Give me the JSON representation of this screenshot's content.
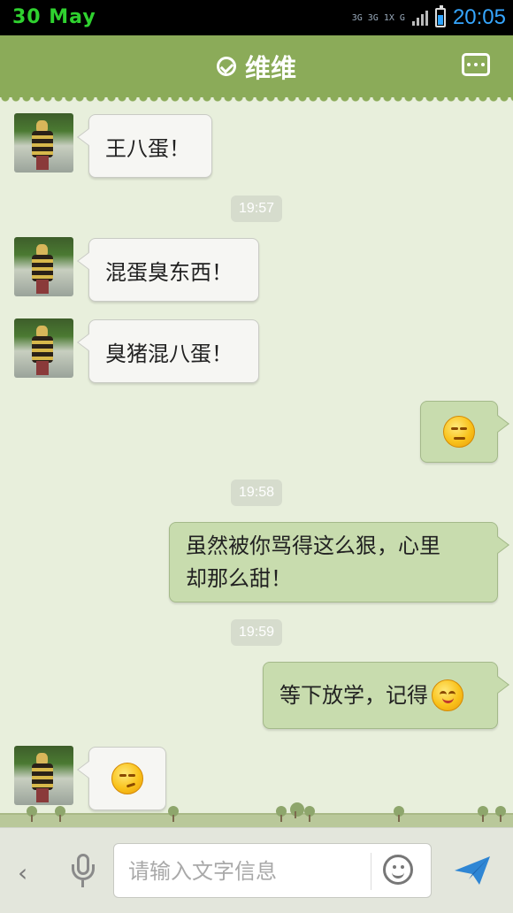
{
  "status_bar": {
    "date": "30 May",
    "network_top": "3G 3G 1X G",
    "time": "20:05"
  },
  "header": {
    "title": "维维",
    "status_icon": "check-circle-icon",
    "more_icon": "more-dots-icon"
  },
  "messages": [
    {
      "type": "in",
      "text": "王八蛋！"
    },
    {
      "type": "time",
      "text": "19:57"
    },
    {
      "type": "in",
      "text": "混蛋臭东西！"
    },
    {
      "type": "in",
      "text": "臭猪混八蛋！"
    },
    {
      "type": "out",
      "emoji": "squint-emoji-icon"
    },
    {
      "type": "time",
      "text": "19:58"
    },
    {
      "type": "out",
      "text_line1": "虽然被你骂得这么狠，心里",
      "text_line2": "却那么甜！"
    },
    {
      "type": "time",
      "text": "19:59"
    },
    {
      "type": "out",
      "text": "等下放学，记得",
      "emoji": "smile-emoji-icon"
    },
    {
      "type": "in",
      "emoji": "smirk-emoji-icon"
    }
  ],
  "input_bar": {
    "back_label": "‹",
    "placeholder": "请输入文字信息",
    "mic_icon": "microphone-icon",
    "emoji_button_icon": "smiley-icon",
    "send_icon": "send-icon"
  }
}
